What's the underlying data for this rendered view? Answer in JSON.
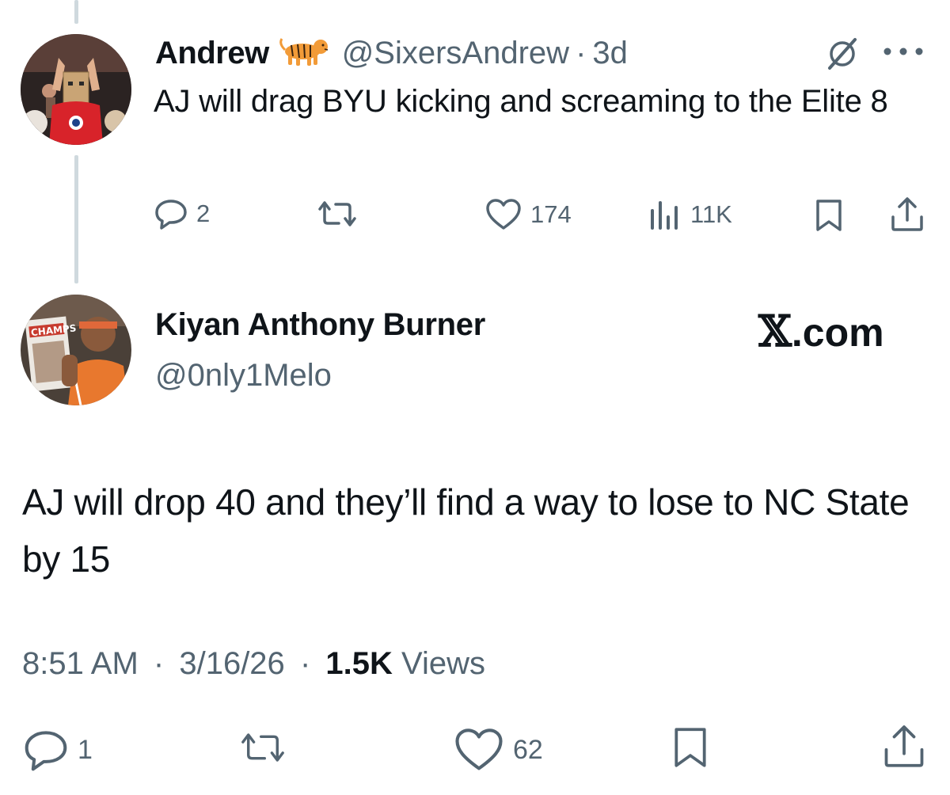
{
  "reply_tweet": {
    "author_name": "Andrew",
    "author_emoji": "tiger",
    "handle": "@SixersAndrew",
    "separator": "·",
    "time": "3d",
    "text": "AJ will drag BYU kicking and screaming to the Elite 8",
    "actions": {
      "replies": "2",
      "reposts": "",
      "likes": "174",
      "views": "11K"
    }
  },
  "main_tweet": {
    "author_name": "Kiyan Anthony Burner",
    "handle": "@0nly1Melo",
    "text": "AJ will drop 40 and they’ll find a way to lose to NC State by 15",
    "timestamp": "8:51 AM",
    "date": "3/16/26",
    "separator": "·",
    "views_count": "1.5K",
    "views_label": "Views",
    "actions": {
      "replies": "1",
      "reposts": "",
      "likes": "62"
    }
  },
  "watermark": {
    "logo": "𝕏",
    "suffix": ".com"
  },
  "icons": {
    "reply": "reply-icon",
    "repost": "repost-icon",
    "like": "heart-icon",
    "views": "views-chart-icon",
    "bookmark": "bookmark-icon",
    "share": "share-icon",
    "grok": "grok-icon",
    "more": "more-icon"
  },
  "colors": {
    "text_primary": "#0f1419",
    "text_secondary": "#536471",
    "thread_line": "#cfd9de"
  }
}
